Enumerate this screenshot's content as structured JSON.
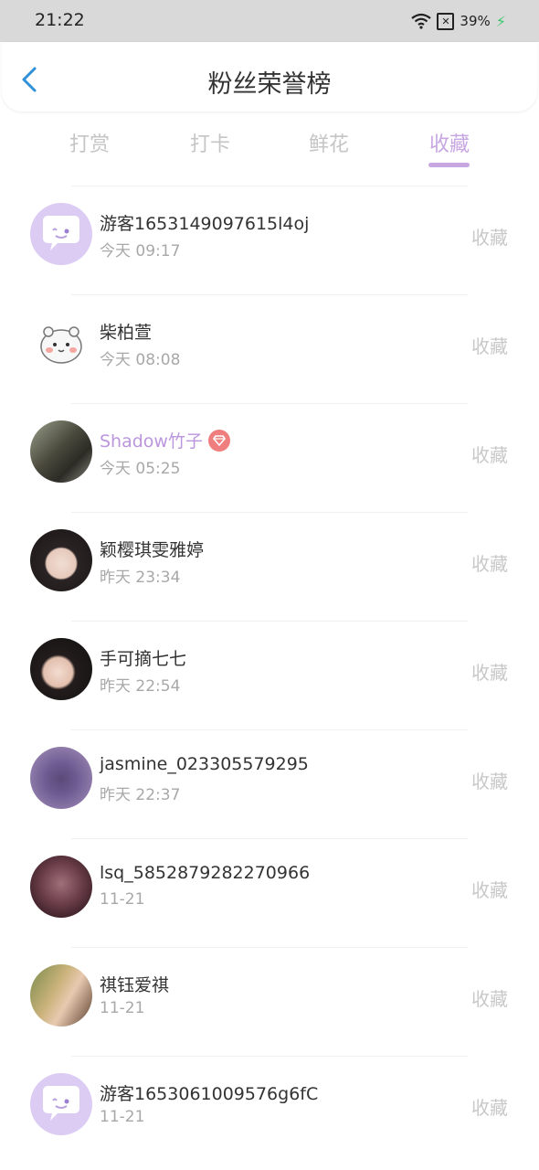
{
  "status": {
    "time": "21:22",
    "battery": "39%"
  },
  "header": {
    "title": "粉丝荣誉榜"
  },
  "tabs": [
    {
      "label": "打赏"
    },
    {
      "label": "打卡"
    },
    {
      "label": "鲜花"
    },
    {
      "label": "收藏"
    }
  ],
  "active_tab": "收藏",
  "fans": [
    {
      "name": "游客1653149097615l4oj",
      "time": "今天 09:17",
      "action": "收藏"
    },
    {
      "name": "柴柏萱",
      "time": "今天 08:08",
      "action": "收藏"
    },
    {
      "name": "Shadow竹子",
      "time": "今天 05:25",
      "action": "收藏"
    },
    {
      "name": "颖樱琪雯雅婷",
      "time": "昨天 23:34",
      "action": "收藏"
    },
    {
      "name": "手可摘七七",
      "time": "昨天 22:54",
      "action": "收藏"
    },
    {
      "name": "jasmine_023305579295",
      "time": "昨天 22:37",
      "action": "收藏"
    },
    {
      "name": "lsq_5852879282270966",
      "time": "11-21",
      "action": "收藏"
    },
    {
      "name": "祺钰爱祺",
      "time": "11-21",
      "action": "收藏"
    },
    {
      "name": "游客1653061009576g6fC",
      "time": "11-21",
      "action": "收藏"
    }
  ],
  "colors": {
    "accent": "#c8a6e2",
    "vip_name": "#bb96dc",
    "badge": "#ef7f7f"
  }
}
